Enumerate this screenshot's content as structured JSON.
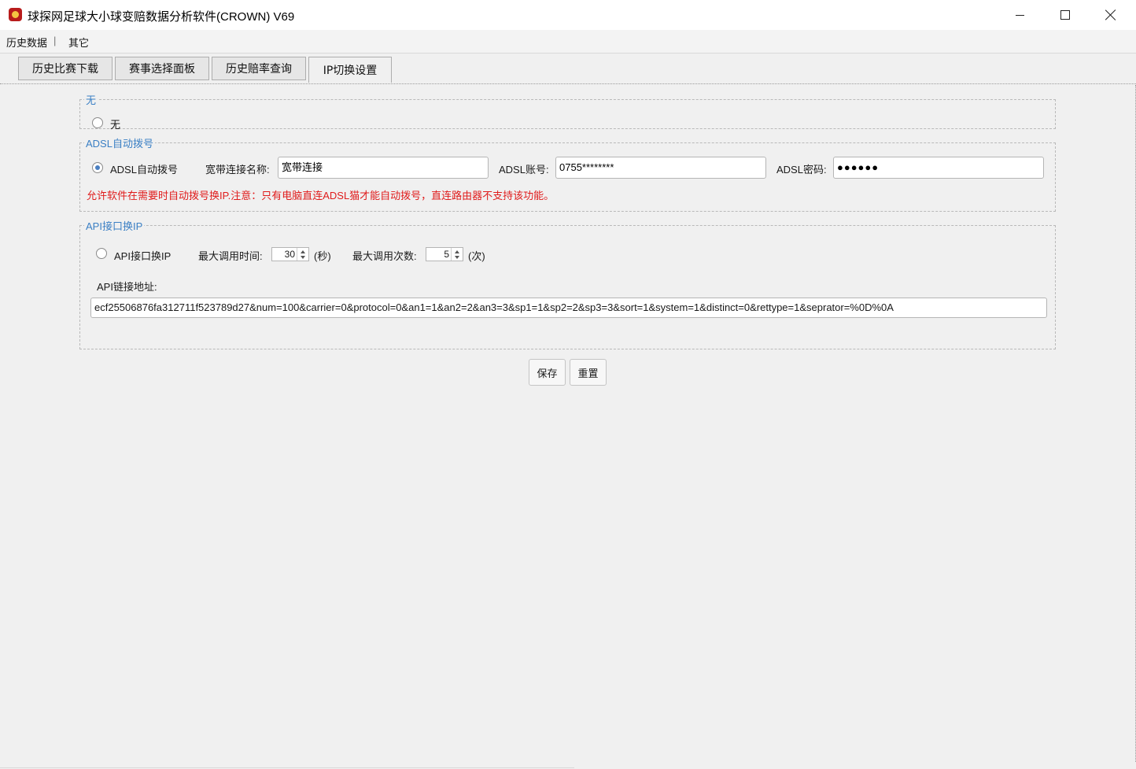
{
  "window": {
    "title": "球探网足球大小球变赔数据分析软件(CROWN) V69"
  },
  "menu": {
    "items": [
      "历史数据",
      "|",
      "其它"
    ]
  },
  "tabs": [
    {
      "label": "历史比赛下载",
      "active": false
    },
    {
      "label": "赛事选择面板",
      "active": false
    },
    {
      "label": "历史赔率查询",
      "active": false
    },
    {
      "label": "IP切换设置",
      "active": true
    }
  ],
  "group_none": {
    "legend": "无",
    "radio_label": "无",
    "selected": false
  },
  "group_adsl": {
    "legend": "ADSL自动拨号",
    "radio_label": "ADSL自动拨号",
    "selected": true,
    "conn_name_label": "宽带连接名称:",
    "conn_name_value": "宽带连接",
    "account_label": "ADSL账号:",
    "account_value": "0755********",
    "password_label": "ADSL密码:",
    "password_value": "●●●●●●",
    "notice": "允许软件在需要时自动拨号换IP.注意：只有电脑直连ADSL猫才能自动拨号，直连路由器不支持该功能。"
  },
  "group_api": {
    "legend": "API接口换IP",
    "radio_label": "API接口换IP",
    "selected": false,
    "max_time_label": "最大调用时间:",
    "max_time_value": "30",
    "max_time_unit": "(秒)",
    "max_count_label": "最大调用次数:",
    "max_count_value": "5",
    "max_count_unit": "(次)",
    "url_label": "API链接地址:",
    "url_value": "ecf25506876fa312711f523789d27&num=100&carrier=0&protocol=0&an1=1&an2=2&an3=3&sp1=1&sp2=2&sp3=3&sort=1&system=1&distinct=0&rettype=1&seprator=%0D%0A"
  },
  "buttons": {
    "save": "保存",
    "reset": "重置"
  },
  "colors": {
    "legend": "#3a7fc4",
    "notice": "#e01b1b",
    "radio_checked": "#4a7fc1"
  },
  "icons": {
    "app": "crown-bear-icon"
  }
}
